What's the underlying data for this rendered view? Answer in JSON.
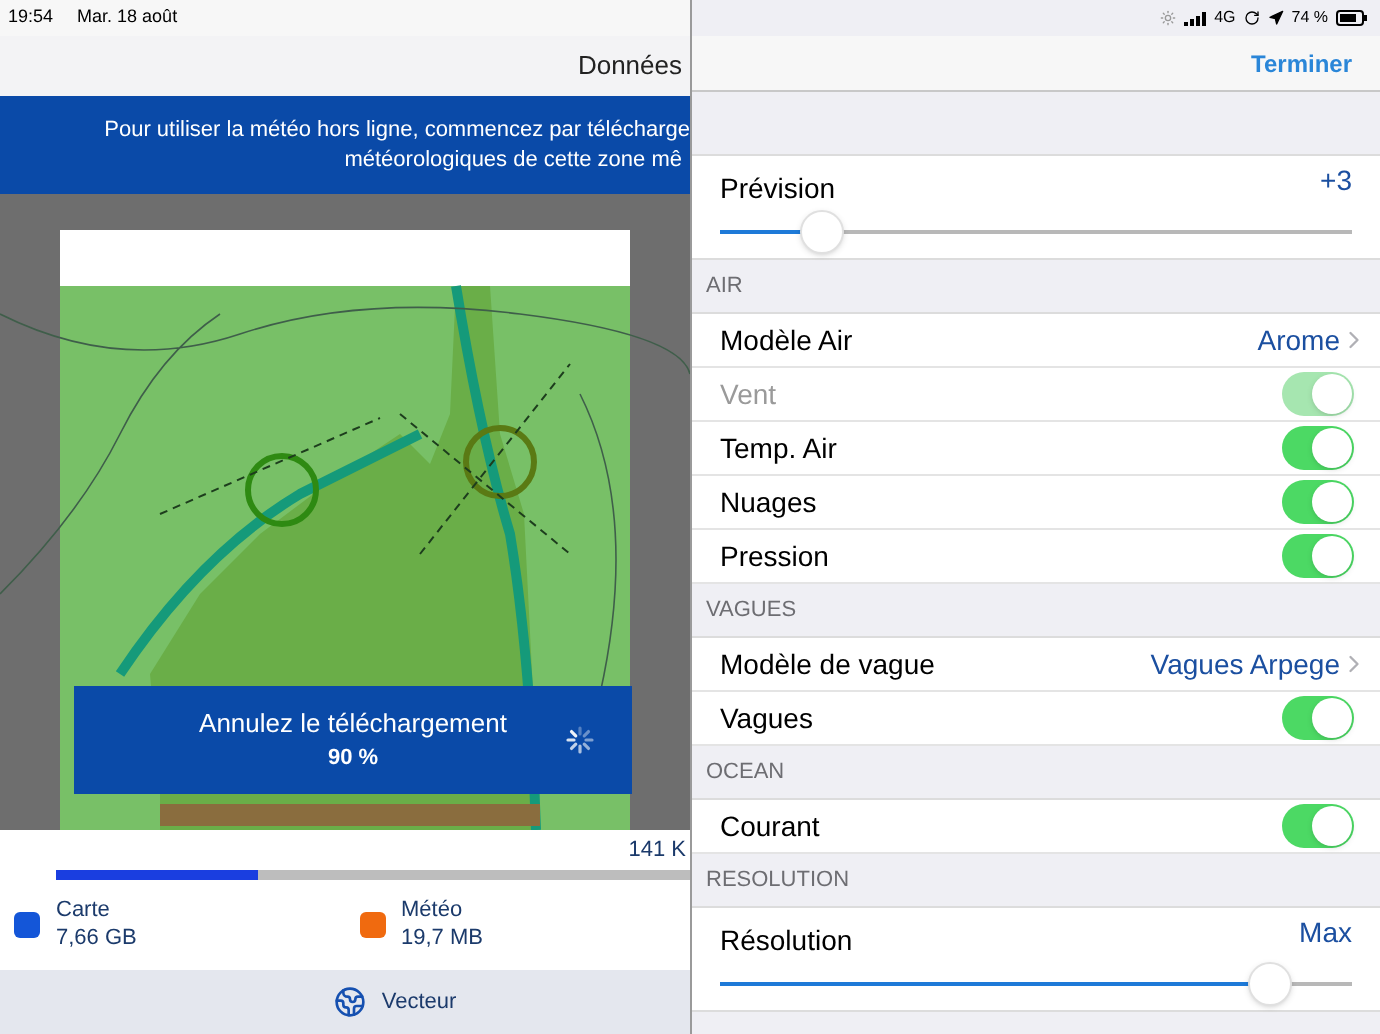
{
  "left_panel": {
    "status_bar": {
      "time": "19:54",
      "date": "Mar. 18 août"
    },
    "nav_title": "Données",
    "banner": [
      "Pour utiliser la météo hors ligne, commencez par télécharge",
      "météorologiques de cette zone mê"
    ],
    "download": {
      "label": "Annulez le téléchargement",
      "percent": "90 %"
    },
    "storage": {
      "total": "141 K",
      "level": 0.32,
      "legend": [
        {
          "name": "Carte",
          "size": "7,66 GB",
          "color": "#1456d8"
        },
        {
          "name": "Météo",
          "size": "19,7 MB",
          "color": "#f06a0f"
        }
      ]
    },
    "toolbar": {
      "label": "Vecteur"
    }
  },
  "right_panel": {
    "status_bar": {
      "network": "4G",
      "battery": "74 %"
    },
    "done_button": "Terminer",
    "sections": [
      {
        "rows": [
          {
            "kind": "slider",
            "label": "Prévision",
            "value": "+3",
            "level": 0.16
          }
        ]
      },
      {
        "header": "AIR",
        "rows": [
          {
            "kind": "link",
            "label": "Modèle Air",
            "value": "Arome"
          },
          {
            "kind": "toggle",
            "label": "Vent",
            "on": true,
            "disabled": true
          },
          {
            "kind": "toggle",
            "label": "Temp. Air",
            "on": true,
            "disabled": false
          },
          {
            "kind": "toggle",
            "label": "Nuages",
            "on": true,
            "disabled": false
          },
          {
            "kind": "toggle",
            "label": "Pression",
            "on": true,
            "disabled": false
          }
        ]
      },
      {
        "header": "VAGUES",
        "rows": [
          {
            "kind": "link",
            "label": "Modèle de vague",
            "value": "Vagues Arpege"
          },
          {
            "kind": "toggle",
            "label": "Vagues",
            "on": true,
            "disabled": false
          }
        ]
      },
      {
        "header": "OCEAN",
        "rows": [
          {
            "kind": "toggle",
            "label": "Courant",
            "on": true,
            "disabled": false
          }
        ]
      },
      {
        "header": "RESOLUTION",
        "rows": [
          {
            "kind": "slider",
            "label": "Résolution",
            "value": "Max",
            "level": 0.87
          }
        ]
      }
    ]
  }
}
